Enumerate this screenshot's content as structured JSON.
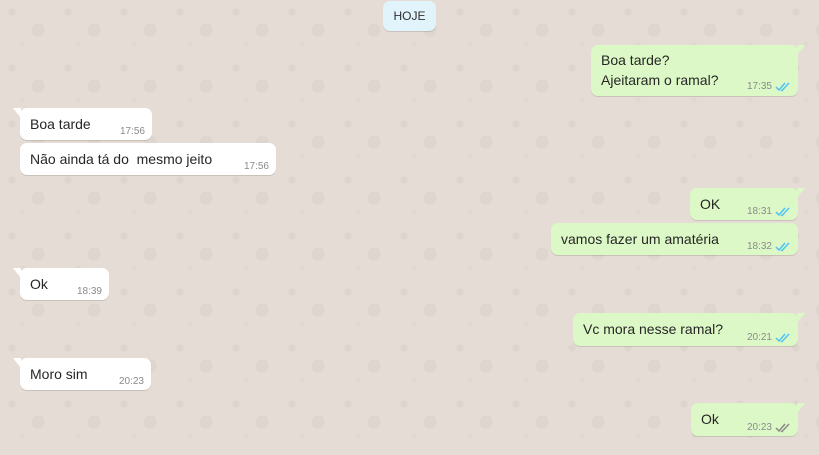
{
  "date_badge": "HOJE",
  "colors": {
    "background": "#e5ddd5",
    "incoming_bubble": "#ffffff",
    "outgoing_bubble": "#dcf8c6",
    "date_badge": "#e1f3fb",
    "read_tick": "#4fc3f7",
    "delivered_tick": "#8a8a8a"
  },
  "messages": [
    {
      "direction": "out",
      "text": "Boa tarde?\nAjeitaram o ramal?",
      "time": "17:35",
      "status": "read",
      "icon": "double-check-icon"
    },
    {
      "direction": "in",
      "text": "Boa tarde",
      "time": "17:56"
    },
    {
      "direction": "in",
      "text": "Não ainda tá do  mesmo jeito",
      "time": "17:56"
    },
    {
      "direction": "out",
      "text": "OK",
      "time": "18:31",
      "status": "read",
      "icon": "double-check-icon"
    },
    {
      "direction": "out",
      "text": "vamos fazer um amatéria",
      "time": "18:32",
      "status": "read",
      "icon": "double-check-icon"
    },
    {
      "direction": "in",
      "text": "Ok",
      "time": "18:39"
    },
    {
      "direction": "out",
      "text": "Vc mora nesse ramal?",
      "time": "20:21",
      "status": "read",
      "icon": "double-check-icon"
    },
    {
      "direction": "in",
      "text": "Moro sim",
      "time": "20:23"
    },
    {
      "direction": "out",
      "text": "Ok",
      "time": "20:23",
      "status": "delivered",
      "icon": "double-check-icon"
    }
  ]
}
